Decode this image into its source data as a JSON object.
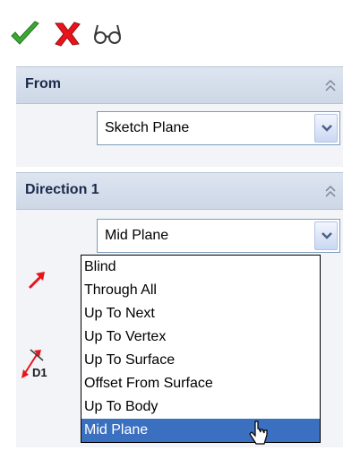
{
  "toolbar": {
    "icons": [
      "ok-check-icon",
      "cancel-x-icon",
      "detail-preview-glasses-icon"
    ]
  },
  "from": {
    "title": "From",
    "value": "Sketch Plane"
  },
  "direction1": {
    "title": "Direction 1",
    "value": "Mid Plane",
    "options": [
      "Blind",
      "Through All",
      "Up To Next",
      "Up To Vertex",
      "Up To Surface",
      "Offset From Surface",
      "Up To Body",
      "Mid Plane"
    ],
    "selected_option": "Mid Plane",
    "depth_label": "D1"
  },
  "colors": {
    "header": "#d4dcea",
    "selection": "#3b6fc0",
    "accent_red": "#e8141c",
    "ok_green": "#3fa535"
  }
}
